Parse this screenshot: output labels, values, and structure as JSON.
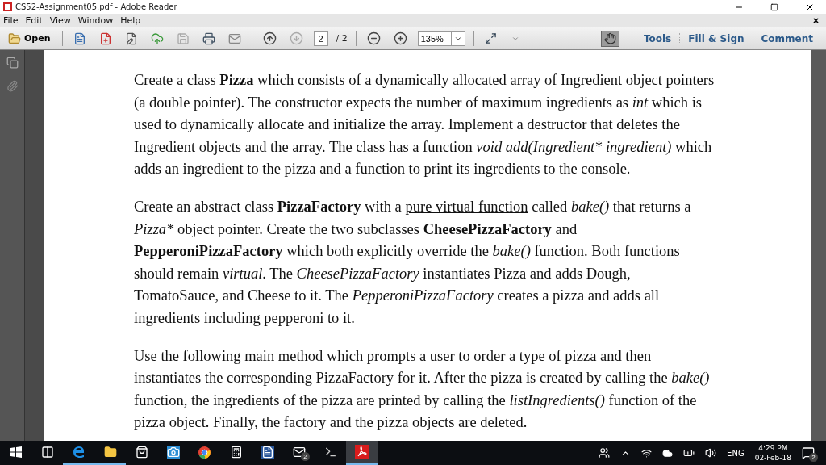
{
  "window": {
    "title": "CS52-Assignment05.pdf - Adobe Reader"
  },
  "menu": [
    "File",
    "Edit",
    "View",
    "Window",
    "Help"
  ],
  "toolbar": {
    "open_label": "Open",
    "page_current": "2",
    "page_total": "/ 2",
    "zoom": "135%",
    "hand_tool_selected": true,
    "panes": [
      "Tools",
      "Fill & Sign",
      "Comment"
    ]
  },
  "document": {
    "paragraphs": [
      {
        "segments": [
          {
            "text": "Create a class ",
            "kind": "regular"
          },
          {
            "text": "Pizza",
            "kind": "bold"
          },
          {
            "text": " which consists of a dynamically allocated array of Ingredient object pointers\n(a double pointer). The constructor expects the number of maximum ingredients as ",
            "kind": "regular"
          },
          {
            "text": "int",
            "kind": "italic"
          },
          {
            "text": " which is\nused to dynamically allocate and initialize the array. Implement a destructor that deletes the\nIngredient objects and the array. The class has a function ",
            "kind": "regular"
          },
          {
            "text": "void add(Ingredient* ingredient)",
            "kind": "italic"
          },
          {
            "text": " which\nadds an ingredient to the pizza and a function to print its ingredients to the console.",
            "kind": "regular"
          }
        ]
      },
      {
        "segments": [
          {
            "text": "Create an abstract class ",
            "kind": "regular"
          },
          {
            "text": "PizzaFactory",
            "kind": "bold"
          },
          {
            "text": " with a ",
            "kind": "regular"
          },
          {
            "text": "pure virtual function",
            "kind": "underline"
          },
          {
            "text": " called ",
            "kind": "regular"
          },
          {
            "text": "bake()",
            "kind": "italic"
          },
          {
            "text": " that returns a\n",
            "kind": "regular"
          },
          {
            "text": "Pizza*",
            "kind": "italic"
          },
          {
            "text": " object pointer. Create the two subclasses ",
            "kind": "regular"
          },
          {
            "text": "CheesePizzaFactory",
            "kind": "bold"
          },
          {
            "text": " and\n",
            "kind": "regular"
          },
          {
            "text": "PepperoniPizzaFactory",
            "kind": "bold"
          },
          {
            "text": " which both explicitly override the ",
            "kind": "regular"
          },
          {
            "text": "bake()",
            "kind": "italic"
          },
          {
            "text": " function. Both functions\nshould remain ",
            "kind": "regular"
          },
          {
            "text": "virtual",
            "kind": "italic"
          },
          {
            "text": ". The ",
            "kind": "regular"
          },
          {
            "text": "CheesePizzaFactory",
            "kind": "italic"
          },
          {
            "text": " instantiates Pizza and adds Dough,\nTomatoSauce, and Cheese to it. The ",
            "kind": "regular"
          },
          {
            "text": "PepperoniPizzaFactory",
            "kind": "italic"
          },
          {
            "text": " creates a pizza and adds all\ningredients including pepperoni to it.",
            "kind": "regular"
          }
        ]
      },
      {
        "segments": [
          {
            "text": "Use the following main method which prompts a user to order a type of pizza and then\ninstantiates the corresponding PizzaFactory for it. After the pizza is created by calling the ",
            "kind": "regular"
          },
          {
            "text": "bake()",
            "kind": "italic"
          },
          {
            "text": "\nfunction, the ingredients of the pizza are printed by calling the ",
            "kind": "regular"
          },
          {
            "text": "listIngredients()",
            "kind": "italic"
          },
          {
            "text": " function of the\npizza object. Finally, the factory and the pizza objects are deleted.",
            "kind": "regular"
          }
        ]
      }
    ]
  },
  "taskbar": {
    "apps": [
      {
        "kind": "taskview",
        "running": false,
        "selected": false
      },
      {
        "kind": "edge",
        "running": true,
        "selected": false
      },
      {
        "kind": "explorer",
        "running": true,
        "selected": false
      },
      {
        "kind": "store",
        "running": false,
        "selected": false
      },
      {
        "kind": "camera",
        "running": false,
        "selected": false
      },
      {
        "kind": "chrome",
        "running": false,
        "selected": false
      },
      {
        "kind": "calculator",
        "running": false,
        "selected": false
      },
      {
        "kind": "word",
        "running": false,
        "selected": false
      },
      {
        "kind": "mail",
        "running": false,
        "selected": false,
        "badge": "2"
      },
      {
        "kind": "terminal",
        "running": false,
        "selected": false
      },
      {
        "kind": "acrobat",
        "running": true,
        "selected": true
      }
    ],
    "language": "ENG",
    "time": "4:29 PM",
    "date": "02-Feb-18",
    "notifications": "2"
  }
}
